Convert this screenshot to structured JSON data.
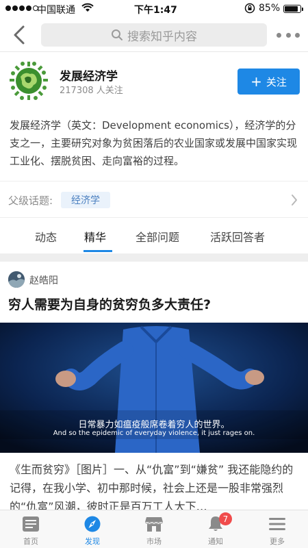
{
  "status_bar": {
    "carrier": "中国联通",
    "time": "下午1:47",
    "battery_text": "85%",
    "battery_level": 0.85
  },
  "nav": {
    "search_placeholder": "搜索知乎内容",
    "icons": {
      "back": "chevron-left-icon",
      "search": "search-icon",
      "more": "more-dots-icon"
    }
  },
  "topic": {
    "name": "发展经济学",
    "followers": "217308 人关注",
    "follow_label": "关注",
    "description": "发展经济学（英文：Development economics），经济学的分支之一，主要研究对象为贫困落后的农业国家或发展中国家实现工业化、摆脱贫困、走向富裕的过程。",
    "parent_label": "父级话题:",
    "parent_tag": "经济学"
  },
  "tabs": [
    {
      "label": "动态",
      "active": false
    },
    {
      "label": "精华",
      "active": true
    },
    {
      "label": "全部问题",
      "active": false
    },
    {
      "label": "活跃回答者",
      "active": false
    }
  ],
  "feed_item": {
    "author": "赵皓阳",
    "question": "穷人需要为自身的贫穷负多大责任?",
    "video_subtitle_cn": "日常暴力如瘟疫般席卷着穷人的世界。",
    "video_subtitle_en": "And so the epidemic of everyday violence, it just rages on.",
    "excerpt": "《生而贫穷》［图片］一、从“仇富”到“嫌贫” 我还能隐约的记得，在我小学、初中那时候，社会上还是一股非常强烈的“仇富”风潮，彼时正是百万工人大下…"
  },
  "tabbar": [
    {
      "label": "首页",
      "icon": "home-doc-icon",
      "active": false
    },
    {
      "label": "发现",
      "icon": "compass-icon",
      "active": true
    },
    {
      "label": "市场",
      "icon": "store-icon",
      "active": false
    },
    {
      "label": "通知",
      "icon": "bell-icon",
      "active": false,
      "badge": "7"
    },
    {
      "label": "更多",
      "icon": "menu-icon",
      "active": false
    }
  ],
  "colors": {
    "accent": "#1e88e5",
    "badge": "#f04b4b",
    "tag_bg": "#eaf2fb"
  }
}
